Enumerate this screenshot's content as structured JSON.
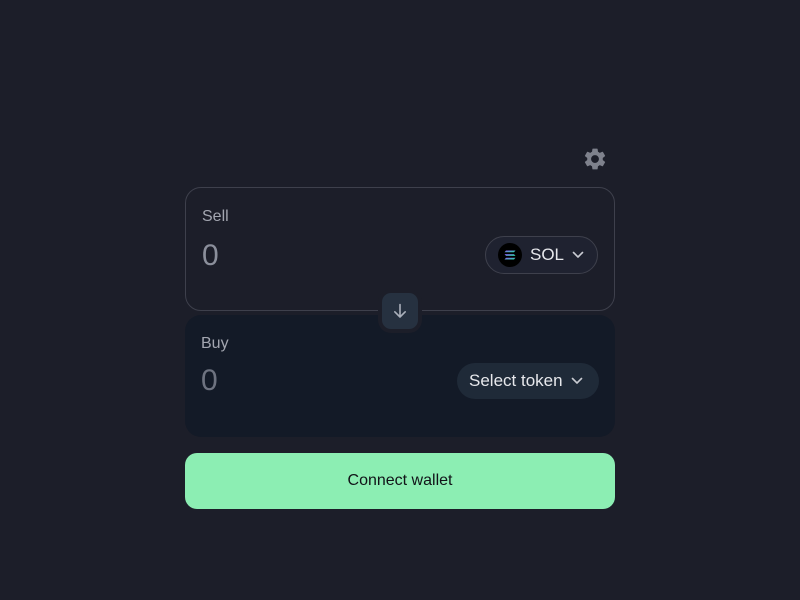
{
  "settings": {
    "icon": "gear-icon"
  },
  "sell": {
    "label": "Sell",
    "amount_placeholder": "0",
    "token": {
      "symbol": "SOL",
      "icon": "solana-logo-icon"
    }
  },
  "switch": {
    "icon": "arrow-down-icon"
  },
  "buy": {
    "label": "Buy",
    "amount_placeholder": "0",
    "token_button_label": "Select token"
  },
  "connect_button_label": "Connect wallet",
  "colors": {
    "background": "#1c1e29",
    "buy_panel": "#131a27",
    "accent": "#8ceeb3",
    "border": "#3e404c"
  }
}
